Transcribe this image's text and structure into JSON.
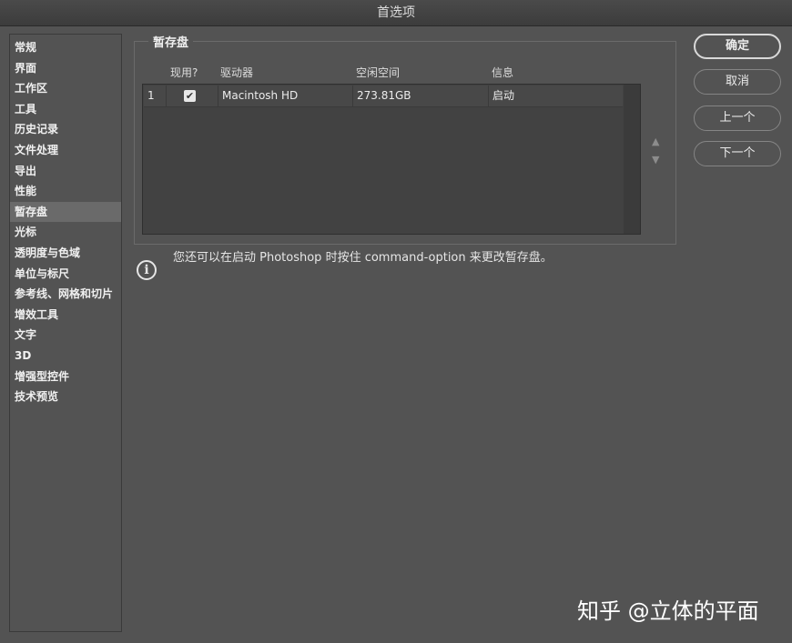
{
  "window": {
    "title": "首选项"
  },
  "sidebar": {
    "items": [
      {
        "label": "常规"
      },
      {
        "label": "界面"
      },
      {
        "label": "工作区"
      },
      {
        "label": "工具"
      },
      {
        "label": "历史记录"
      },
      {
        "label": "文件处理"
      },
      {
        "label": "导出"
      },
      {
        "label": "性能"
      },
      {
        "label": "暂存盘"
      },
      {
        "label": "光标"
      },
      {
        "label": "透明度与色域"
      },
      {
        "label": "单位与标尺"
      },
      {
        "label": "参考线、网格和切片"
      },
      {
        "label": "增效工具"
      },
      {
        "label": "文字"
      },
      {
        "label": "3D"
      },
      {
        "label": "增强型控件"
      },
      {
        "label": "技术预览"
      }
    ],
    "active_index": 8
  },
  "scratch": {
    "group_title": "暂存盘",
    "columns": {
      "active": "现用?",
      "drive": "驱动器",
      "free": "空闲空间",
      "info": "信息"
    },
    "rows": [
      {
        "index": "1",
        "active": true,
        "drive": "Macintosh HD",
        "free": "273.81GB",
        "info": "启动"
      }
    ],
    "note": "您还可以在启动 Photoshop 时按住 command-option 来更改暂存盘。"
  },
  "buttons": {
    "ok": "确定",
    "cancel": "取消",
    "prev": "上一个",
    "next": "下一个"
  },
  "icons": {
    "checkmark": "✔",
    "up": "▲",
    "down": "▼",
    "info": "i"
  },
  "watermark": "知乎 @立体的平面",
  "colors": {
    "background": "#535353",
    "active_item": "#6a6a6a",
    "table_bg": "#424242"
  }
}
